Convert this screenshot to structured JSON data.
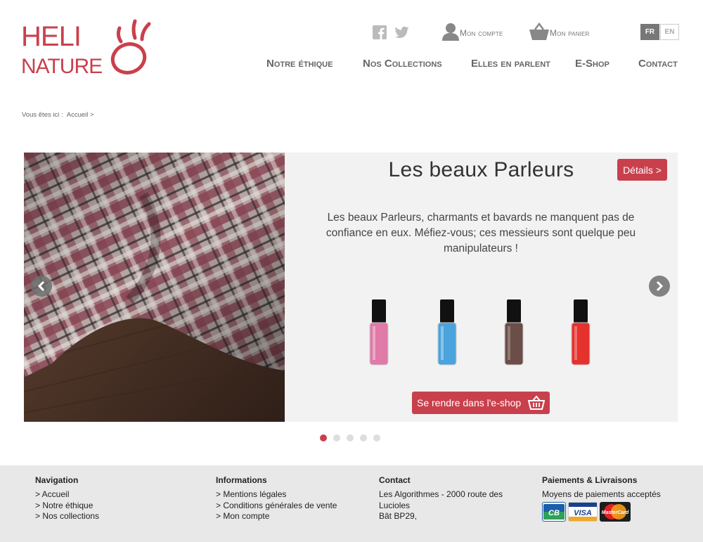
{
  "logo": {
    "line1": "HELI",
    "line2": "NATURE"
  },
  "top": {
    "account": "Mon compte",
    "cart": "Mon panier",
    "lang_fr": "FR",
    "lang_en": "EN"
  },
  "nav": {
    "item1": "Notre éthique",
    "item2": "Nos Collections",
    "item3": "Elles en parlent",
    "item4": "E-Shop",
    "item5": "Contact"
  },
  "breadcrumb": {
    "prefix": "Vous êtes ici :",
    "home": "Accueil >"
  },
  "slide": {
    "title": "Les beaux Parleurs",
    "details": "Détails >",
    "description": "Les beaux Parleurs, charmants et bavards ne manquent pas de confiance en eux. Méfiez-vous; ces messieurs sont quelque peu manipulateurs !",
    "shop": "Se rendre dans l'e-shop",
    "polish_colors": [
      "#e07aa8",
      "#4aa3dc",
      "#6b4e48",
      "#e5322d"
    ]
  },
  "slider_dots": {
    "count": 5,
    "active": 1
  },
  "footer": {
    "col1": {
      "title": "Navigation",
      "links": [
        "> Accueil",
        "> Notre éthique",
        "> Nos collections"
      ]
    },
    "col2": {
      "title": "Informations",
      "links": [
        "> Mentions légales",
        "> Conditions générales de vente",
        "> Mon compte"
      ]
    },
    "col3": {
      "title": "Contact",
      "lines": [
        "Les Algorithmes - 2000 route des Lucioles",
        "Bât BP29,"
      ]
    },
    "col4": {
      "title": "Paiements & Livraisons",
      "text": "Moyens de paiements acceptés",
      "cards": [
        "CB",
        "VISA",
        "MasterCard"
      ]
    }
  },
  "colors": {
    "brand": "#c9404d",
    "footer_bg": "#e8e8e8",
    "nav_text": "#666666"
  }
}
